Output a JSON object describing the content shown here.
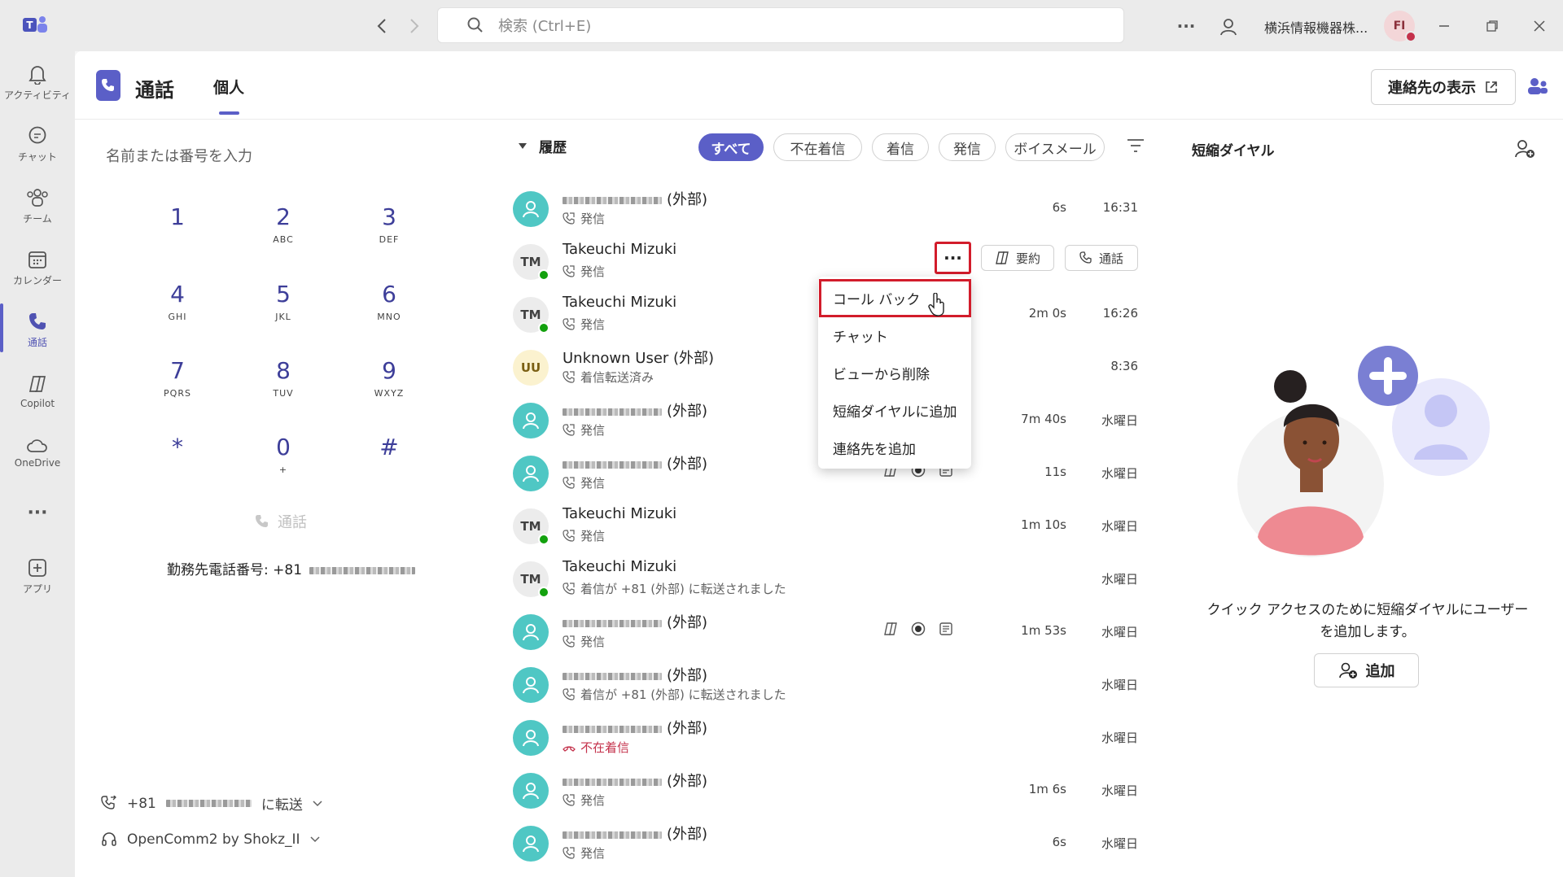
{
  "titlebar": {
    "search_placeholder": "検索 (Ctrl+E)",
    "org_name": "横浜情報機器株...",
    "avatar_initials": "FI"
  },
  "rail": [
    {
      "name": "activity",
      "label": "アクティビティ"
    },
    {
      "name": "chat",
      "label": "チャット"
    },
    {
      "name": "teams",
      "label": "チーム"
    },
    {
      "name": "calendar",
      "label": "カレンダー"
    },
    {
      "name": "calls",
      "label": "通話"
    },
    {
      "name": "copilot",
      "label": "Copilot"
    },
    {
      "name": "onedrive",
      "label": "OneDrive"
    },
    {
      "name": "apps",
      "label": "アプリ"
    }
  ],
  "header": {
    "title": "通話",
    "tab": "個人",
    "show_contacts": "連絡先の表示"
  },
  "dialpad": {
    "input_placeholder": "名前または番号を入力",
    "keys": [
      {
        "d": "1",
        "s": ""
      },
      {
        "d": "2",
        "s": "ABC"
      },
      {
        "d": "3",
        "s": "DEF"
      },
      {
        "d": "4",
        "s": "GHI"
      },
      {
        "d": "5",
        "s": "JKL"
      },
      {
        "d": "6",
        "s": "MNO"
      },
      {
        "d": "7",
        "s": "PQRS"
      },
      {
        "d": "8",
        "s": "TUV"
      },
      {
        "d": "9",
        "s": "WXYZ"
      },
      {
        "d": "*",
        "s": ""
      },
      {
        "d": "0",
        "s": "+"
      },
      {
        "d": "#",
        "s": ""
      }
    ],
    "call_label": "通話",
    "work_number_label": "勤務先電話番号: +81",
    "forward_prefix": "+81",
    "forward_label": "に転送",
    "device_label": "OpenComm2 by Shokz_II"
  },
  "history": {
    "title": "履歴",
    "filters": [
      "すべて",
      "不在着信",
      "着信",
      "発信",
      "ボイスメール"
    ],
    "active_filter": "すべて",
    "row_buttons": {
      "summary": "要約",
      "call": "通話"
    },
    "rows": [
      {
        "avatar": "ext",
        "initials": "",
        "name": "(外部)",
        "blur": true,
        "sub": "発信",
        "dur": "6s",
        "time": "16:31",
        "icons": false
      },
      {
        "avatar": "tm",
        "initials": "TM",
        "name": "Takeuchi Mizuki",
        "blur": false,
        "sub": "発信",
        "dur": "",
        "time": "",
        "icons": false
      },
      {
        "avatar": "tm",
        "initials": "TM",
        "name": "Takeuchi Mizuki",
        "blur": false,
        "sub": "発信",
        "dur": "2m 0s",
        "time": "16:26",
        "icons": false
      },
      {
        "avatar": "uu",
        "initials": "UU",
        "name": "Unknown User (外部)",
        "blur": false,
        "sub": "着信転送済み",
        "dur": "",
        "time": "8:36",
        "icons": false
      },
      {
        "avatar": "ext",
        "initials": "",
        "name": "(外部)",
        "blur": true,
        "sub": "発信",
        "dur": "7m 40s",
        "time": "水曜日",
        "icons": false
      },
      {
        "avatar": "ext",
        "initials": "",
        "name": "(外部)",
        "blur": true,
        "sub": "発信",
        "dur": "11s",
        "time": "水曜日",
        "icons": true
      },
      {
        "avatar": "tm",
        "initials": "TM",
        "name": "Takeuchi Mizuki",
        "blur": false,
        "sub": "発信",
        "dur": "1m 10s",
        "time": "水曜日",
        "icons": false
      },
      {
        "avatar": "tm",
        "initials": "TM",
        "name": "Takeuchi Mizuki",
        "blur": false,
        "sub": "着信が +81 (外部) に転送されました",
        "dur": "",
        "time": "水曜日",
        "icons": false
      },
      {
        "avatar": "ext",
        "initials": "",
        "name": "(外部)",
        "blur": true,
        "sub": "発信",
        "dur": "1m 53s",
        "time": "水曜日",
        "icons": true
      },
      {
        "avatar": "ext",
        "initials": "",
        "name": "(外部)",
        "blur": true,
        "sub": "着信が +81 (外部) に転送されました",
        "dur": "",
        "time": "水曜日",
        "icons": false
      },
      {
        "avatar": "ext",
        "initials": "",
        "name": "(外部)",
        "blur": true,
        "sub": "不在着信",
        "dur": "",
        "time": "水曜日",
        "icons": false,
        "missed": true
      },
      {
        "avatar": "ext",
        "initials": "",
        "name": "(外部)",
        "blur": true,
        "sub": "発信",
        "dur": "1m 6s",
        "time": "水曜日",
        "icons": false
      },
      {
        "avatar": "ext",
        "initials": "",
        "name": "(外部)",
        "blur": true,
        "sub": "発信",
        "dur": "6s",
        "time": "水曜日",
        "icons": false
      }
    ]
  },
  "context_menu": {
    "items": [
      "コール バック",
      "チャット",
      "ビューから削除",
      "短縮ダイヤルに追加",
      "連絡先を追加"
    ]
  },
  "speed_dial": {
    "title": "短縮ダイヤル",
    "empty_text_1": "クイック アクセスのために短縮ダイヤルにユーザー",
    "empty_text_2": "を追加します。",
    "add_label": "追加"
  },
  "colors": {
    "accent": "#5b5fc7",
    "highlight": "#d21c2b",
    "external_avatar": "#4fc7c4",
    "presence": "#13a10e"
  }
}
